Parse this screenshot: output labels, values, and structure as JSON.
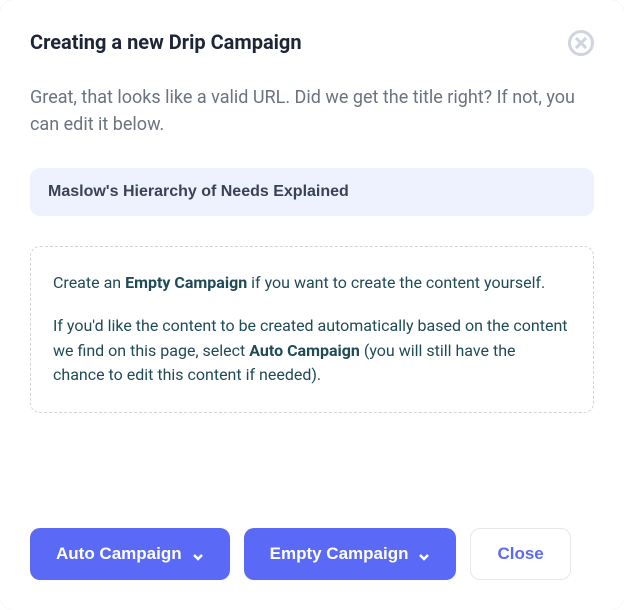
{
  "modal": {
    "title": "Creating a new Drip Campaign",
    "subtitle": "Great, that looks like a valid URL. Did we get the title right? If not, you can edit it below.",
    "input_value": "Maslow's Hierarchy of Needs Explained",
    "info": {
      "p1_prefix": "Create an ",
      "p1_strong": "Empty Campaign",
      "p1_suffix": " if you want to create the content yourself.",
      "p2_prefix": "If you'd like the content to be created automatically based on the content we find on this page, select ",
      "p2_strong": "Auto Campaign",
      "p2_suffix": " (you will still have the chance to edit this content if needed)."
    },
    "buttons": {
      "auto": "Auto Campaign",
      "empty": "Empty Campaign",
      "close": "Close"
    }
  }
}
